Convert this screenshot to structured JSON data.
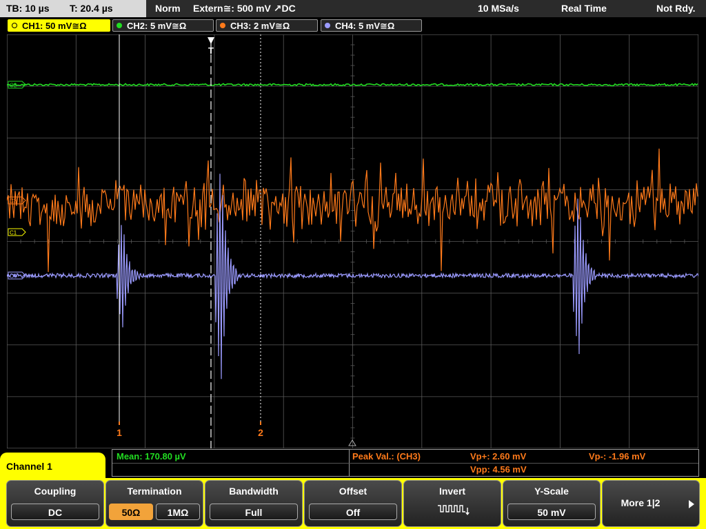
{
  "status": {
    "timebase": "TB: 10 µs",
    "trigger_time": "T: 20.4 µs",
    "trigger_mode": "Norm",
    "trigger_source": "Extern≅: 500 mV ↗DC",
    "sample_rate": "10 MSa/s",
    "acq_mode": "Real Time",
    "state": "Not Rdy."
  },
  "channels": [
    {
      "label": "CH1: 50 mV≅Ω",
      "color": "#ffff00"
    },
    {
      "label": "CH2: 5 mV≅Ω",
      "color": "#22dd22"
    },
    {
      "label": "CH3: 2 mV≅Ω",
      "color": "#ff7a1a"
    },
    {
      "label": "CH4: 5 mV≅Ω",
      "color": "#9b9bff"
    }
  ],
  "markers": {
    "ch2": "C2",
    "ch3": "C3",
    "ch1": "C1",
    "ch4": "C4",
    "trigger": "T",
    "cursor1": "1",
    "cursor2": "2"
  },
  "measurements": {
    "mean": "Mean: 170.80 µV",
    "peak_title": "Peak Val.:  (CH3)",
    "vp_plus": "Vp+: 2.60 mV",
    "vp_minus": "Vp-: -1.96 mV",
    "vpp": "Vpp: 4.56 mV"
  },
  "menu": {
    "title": "Channel 1",
    "coupling": {
      "label": "Coupling",
      "value": "DC"
    },
    "termination": {
      "label": "Termination",
      "opt1": "50Ω",
      "opt2": "1MΩ"
    },
    "bandwidth": {
      "label": "Bandwidth",
      "value": "Full"
    },
    "offset": {
      "label": "Offset",
      "value": "Off"
    },
    "invert": {
      "label": "Invert"
    },
    "yscale": {
      "label": "Y-Scale",
      "value": "50 mV"
    },
    "more": {
      "label": "More 1|2"
    }
  },
  "colors": {
    "grid": "#5a5a5a",
    "ch1": "#ffff00",
    "ch2": "#22dd22",
    "ch3": "#ff7a1a",
    "ch4": "#9b9bff",
    "measure_green": "#22dd22",
    "measure_orange": "#ff7a1a"
  }
}
